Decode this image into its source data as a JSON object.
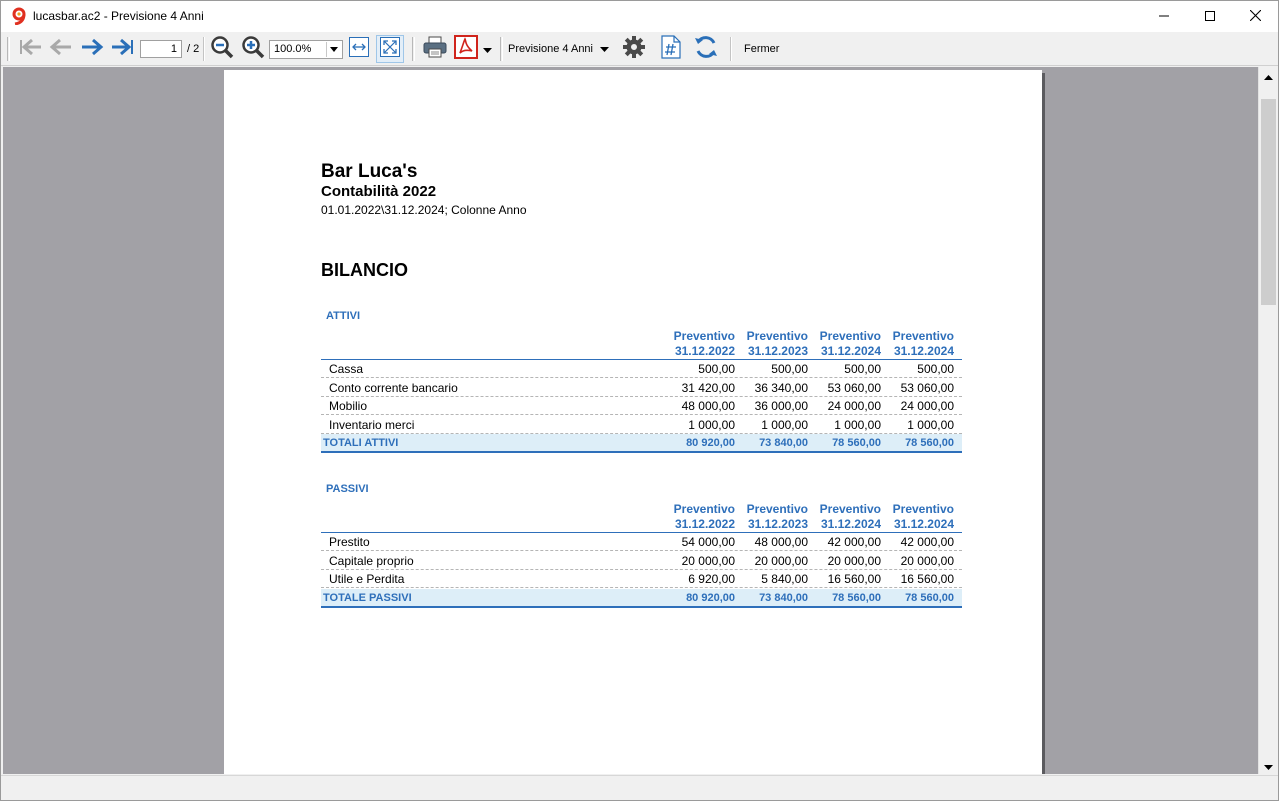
{
  "window": {
    "title": "lucasbar.ac2 - Previsione 4 Anni"
  },
  "toolbar": {
    "page_current": "1",
    "page_total": "/ 2",
    "zoom": "100.0%",
    "report_name": "Previsione 4 Anni",
    "close_label": "Fermer"
  },
  "colors": {
    "accent": "#2e6fba",
    "total_bg": "#ddeef8",
    "viewport_bg": "#a2a1a6",
    "logo": "#e03020"
  },
  "report": {
    "company": "Bar Luca's",
    "subtitle": "Contabilità 2022",
    "period": "01.01.2022\\31.12.2024; Colonne Anno",
    "title": "BILANCIO",
    "columns": [
      {
        "line1": "Preventivo",
        "line2": "31.12.2022"
      },
      {
        "line1": "Preventivo",
        "line2": "31.12.2023"
      },
      {
        "line1": "Preventivo",
        "line2": "31.12.2024"
      },
      {
        "line1": "Preventivo",
        "line2": "31.12.2024"
      }
    ],
    "attivi": {
      "label": "ATTIVI",
      "rows": [
        {
          "desc": "Cassa",
          "v": [
            "500,00",
            "500,00",
            "500,00",
            "500,00"
          ]
        },
        {
          "desc": "Conto corrente bancario",
          "v": [
            "31 420,00",
            "36 340,00",
            "53 060,00",
            "53 060,00"
          ]
        },
        {
          "desc": "Mobilio",
          "v": [
            "48 000,00",
            "36 000,00",
            "24 000,00",
            "24 000,00"
          ]
        },
        {
          "desc": "Inventario merci",
          "v": [
            "1 000,00",
            "1 000,00",
            "1 000,00",
            "1 000,00"
          ]
        }
      ],
      "total": {
        "desc": "TOTALI ATTIVI",
        "v": [
          "80 920,00",
          "73 840,00",
          "78 560,00",
          "78 560,00"
        ]
      }
    },
    "passivi": {
      "label": "PASSIVI",
      "rows": [
        {
          "desc": "Prestito",
          "v": [
            "54 000,00",
            "48 000,00",
            "42 000,00",
            "42 000,00"
          ]
        },
        {
          "desc": "Capitale proprio",
          "v": [
            "20 000,00",
            "20 000,00",
            "20 000,00",
            "20 000,00"
          ]
        },
        {
          "desc": "Utile e Perdita",
          "v": [
            "6 920,00",
            "5 840,00",
            "16 560,00",
            "16 560,00"
          ]
        }
      ],
      "total": {
        "desc": "TOTALE PASSIVI",
        "v": [
          "80 920,00",
          "73 840,00",
          "78 560,00",
          "78 560,00"
        ]
      }
    }
  }
}
